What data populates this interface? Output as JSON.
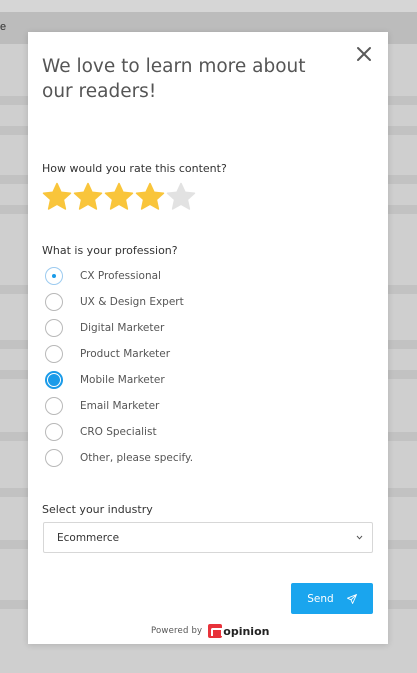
{
  "background": {
    "partial_text": "e"
  },
  "survey": {
    "title": "We love to learn more about our readers!",
    "rating": {
      "label": "How would you rate this content?",
      "value": 4,
      "max": 5,
      "filled_color": "#f9c53b",
      "empty_color": "#e2e2e2"
    },
    "profession": {
      "label": "What is your profession?",
      "options": [
        "CX Professional",
        "UX & Design Expert",
        "Digital Marketer",
        "Product Marketer",
        "Mobile Marketer",
        "Email Marketer",
        "CRO Specialist",
        "Other, please specify."
      ],
      "selected": "Mobile Marketer",
      "focused": "CX Professional"
    },
    "industry": {
      "label": "Select your industry",
      "value": "Ecommerce"
    },
    "send_label": "Send",
    "accent_color": "#1aa5ee"
  },
  "footer": {
    "powered_by": "Powered by",
    "brand": "opinion",
    "brand_color": "#e8333b"
  }
}
